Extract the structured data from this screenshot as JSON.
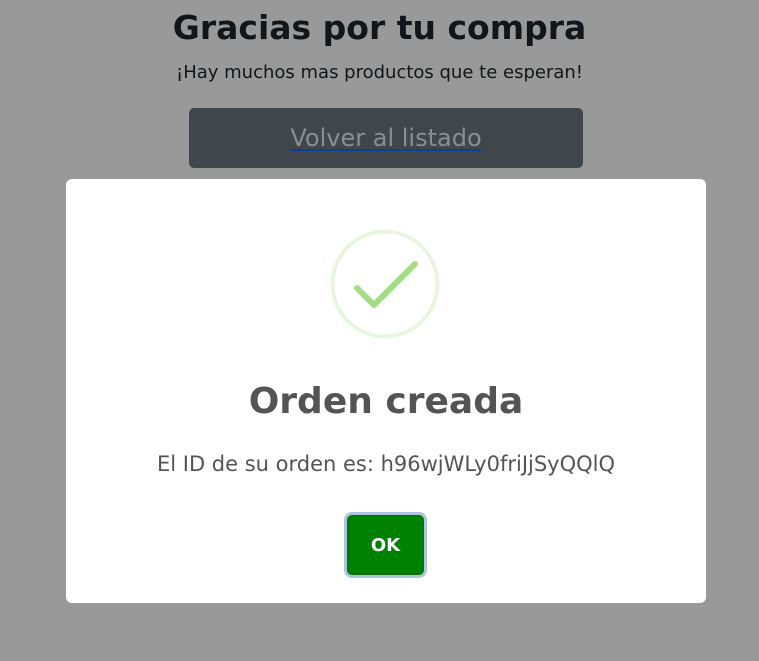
{
  "page": {
    "title": "Gracias por tu compra",
    "subtitle": "¡Hay muchos mas productos que te esperan!",
    "back_link_label": "Volver al listado"
  },
  "modal": {
    "icon": "success-check-icon",
    "title": "Orden creada",
    "message": "El ID de su orden es: h96wjWLy0friJjSyQQlQ",
    "ok_label": "OK"
  },
  "colors": {
    "back_button_bg": "#6c757d",
    "ok_button_bg": "#008000",
    "success_check": "#a5dc86",
    "success_ring": "#e8f6df",
    "modal_text": "#545454",
    "backdrop": "rgba(0,0,0,0.40)"
  }
}
